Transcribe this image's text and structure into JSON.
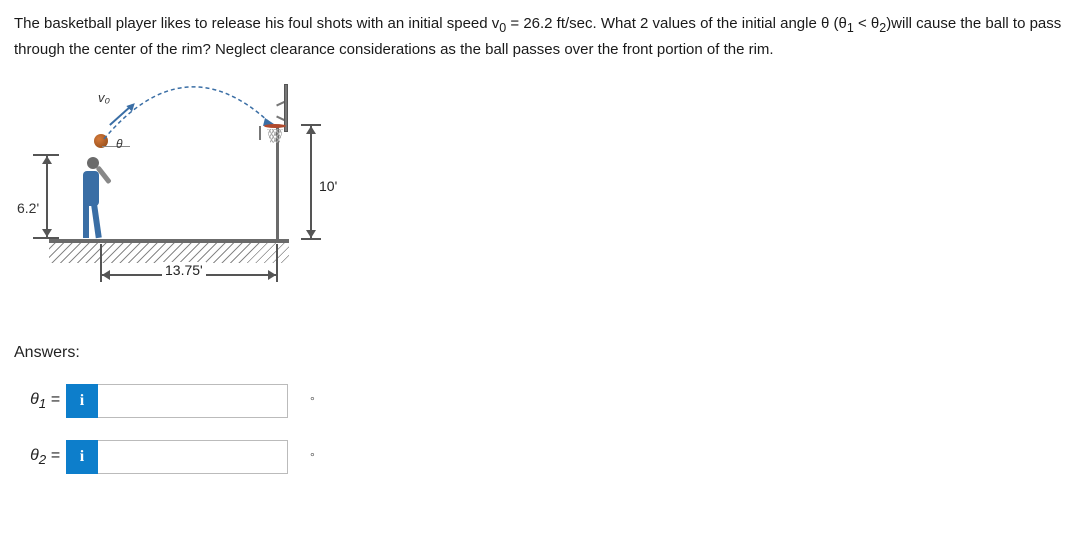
{
  "problem": {
    "text_a": "The basketball player likes to release his foul shots with an initial speed v",
    "v0sub": "0",
    "text_b": " = 26.2 ft/sec. What 2 values of the initial angle θ (θ",
    "sub1": "1",
    "text_c": " < θ",
    "sub2": "2",
    "text_d": ")will cause the ball to pass through the center of the rim? Neglect clearance considerations as the ball passes over the front portion of the rim."
  },
  "figure": {
    "release_height": "6.2'",
    "rim_height": "10'",
    "horiz_dist": "13.75'",
    "v0_label": "v₀",
    "theta_label": "θ"
  },
  "answers": {
    "heading": "Answers:",
    "rows": [
      {
        "label_sym": "θ",
        "label_sub": "1",
        "eq": " = ",
        "info": "i",
        "value": "",
        "unit": "°"
      },
      {
        "label_sym": "θ",
        "label_sub": "2",
        "eq": " = ",
        "info": "i",
        "value": "",
        "unit": "°"
      }
    ]
  }
}
